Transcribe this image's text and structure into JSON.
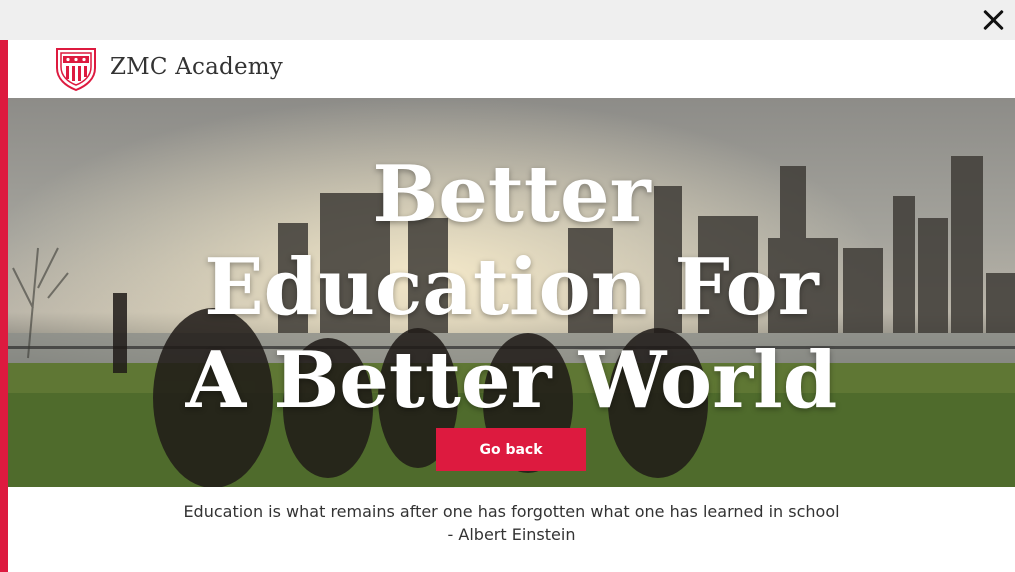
{
  "window": {
    "close_icon": "close-icon"
  },
  "header": {
    "brand": "ZMC Academy",
    "logo_icon": "shield-crest-icon"
  },
  "hero": {
    "headline_lines": [
      "Better",
      "Education For",
      "A Better World"
    ],
    "button_label": "Go back"
  },
  "quote": {
    "text": "Education is what remains after one has forgotten what one has learned in school",
    "author": "- Albert Einstein"
  },
  "colors": {
    "accent": "#dd1a3f",
    "topbar": "#efefef",
    "text": "#333333"
  }
}
